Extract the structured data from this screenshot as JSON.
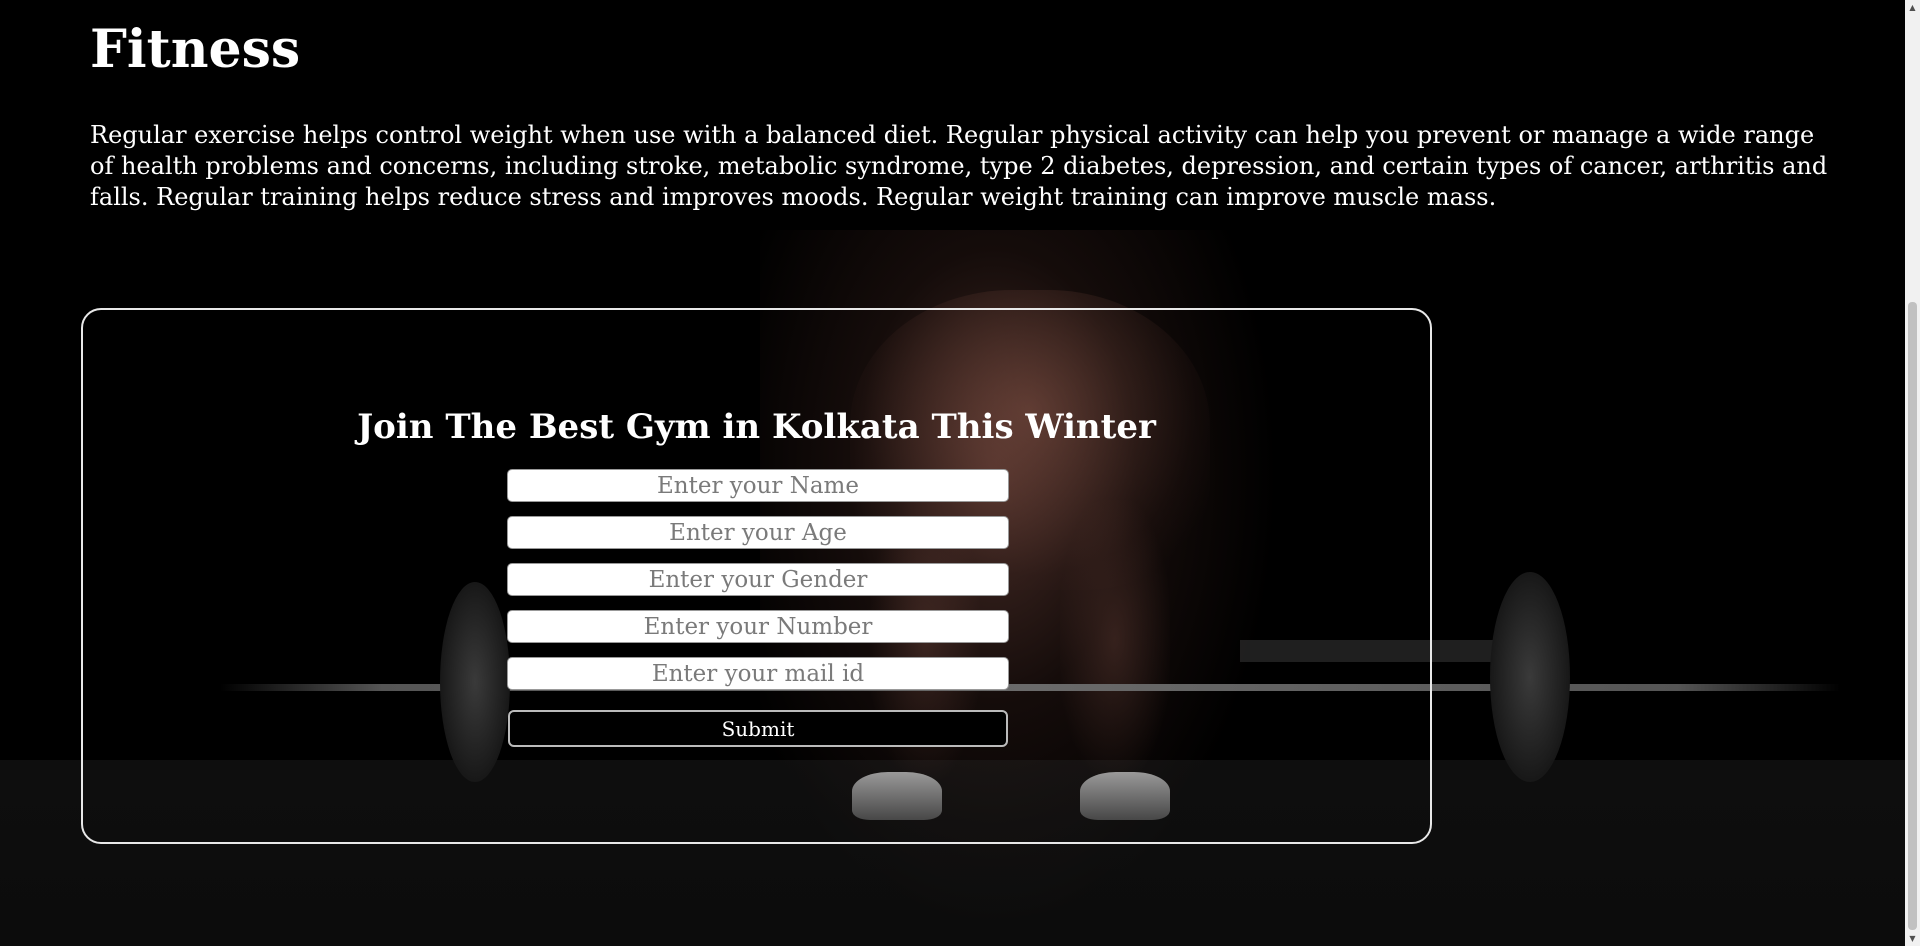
{
  "header": {
    "title": "Fitness",
    "description": "Regular exercise helps control weight when use with a balanced diet. Regular physical activity can help you prevent or manage a wide range of health problems and concerns, including stroke, metabolic syndrome, type 2 diabetes, depression, and certain types of cancer, arthritis and falls. Regular training helps reduce stress and improves moods. Regular weight training can improve muscle mass."
  },
  "form": {
    "heading": "Join The Best Gym in Kolkata This Winter",
    "fields": {
      "name": {
        "placeholder": "Enter your Name",
        "value": ""
      },
      "age": {
        "placeholder": "Enter your Age",
        "value": ""
      },
      "gender": {
        "placeholder": "Enter your Gender",
        "value": ""
      },
      "number": {
        "placeholder": "Enter your Number",
        "value": ""
      },
      "email": {
        "placeholder": "Enter your mail id",
        "value": ""
      }
    },
    "submit_label": "Submit"
  },
  "scrollbar": {
    "up_icon": "triangle-up-icon",
    "down_icon": "triangle-down-icon"
  },
  "colors": {
    "background": "#000000",
    "text": "#ffffff",
    "card_border": "#e8e8e8",
    "input_background": "#ffffff",
    "placeholder": "#7a7a7a",
    "button_background": "#000000"
  }
}
